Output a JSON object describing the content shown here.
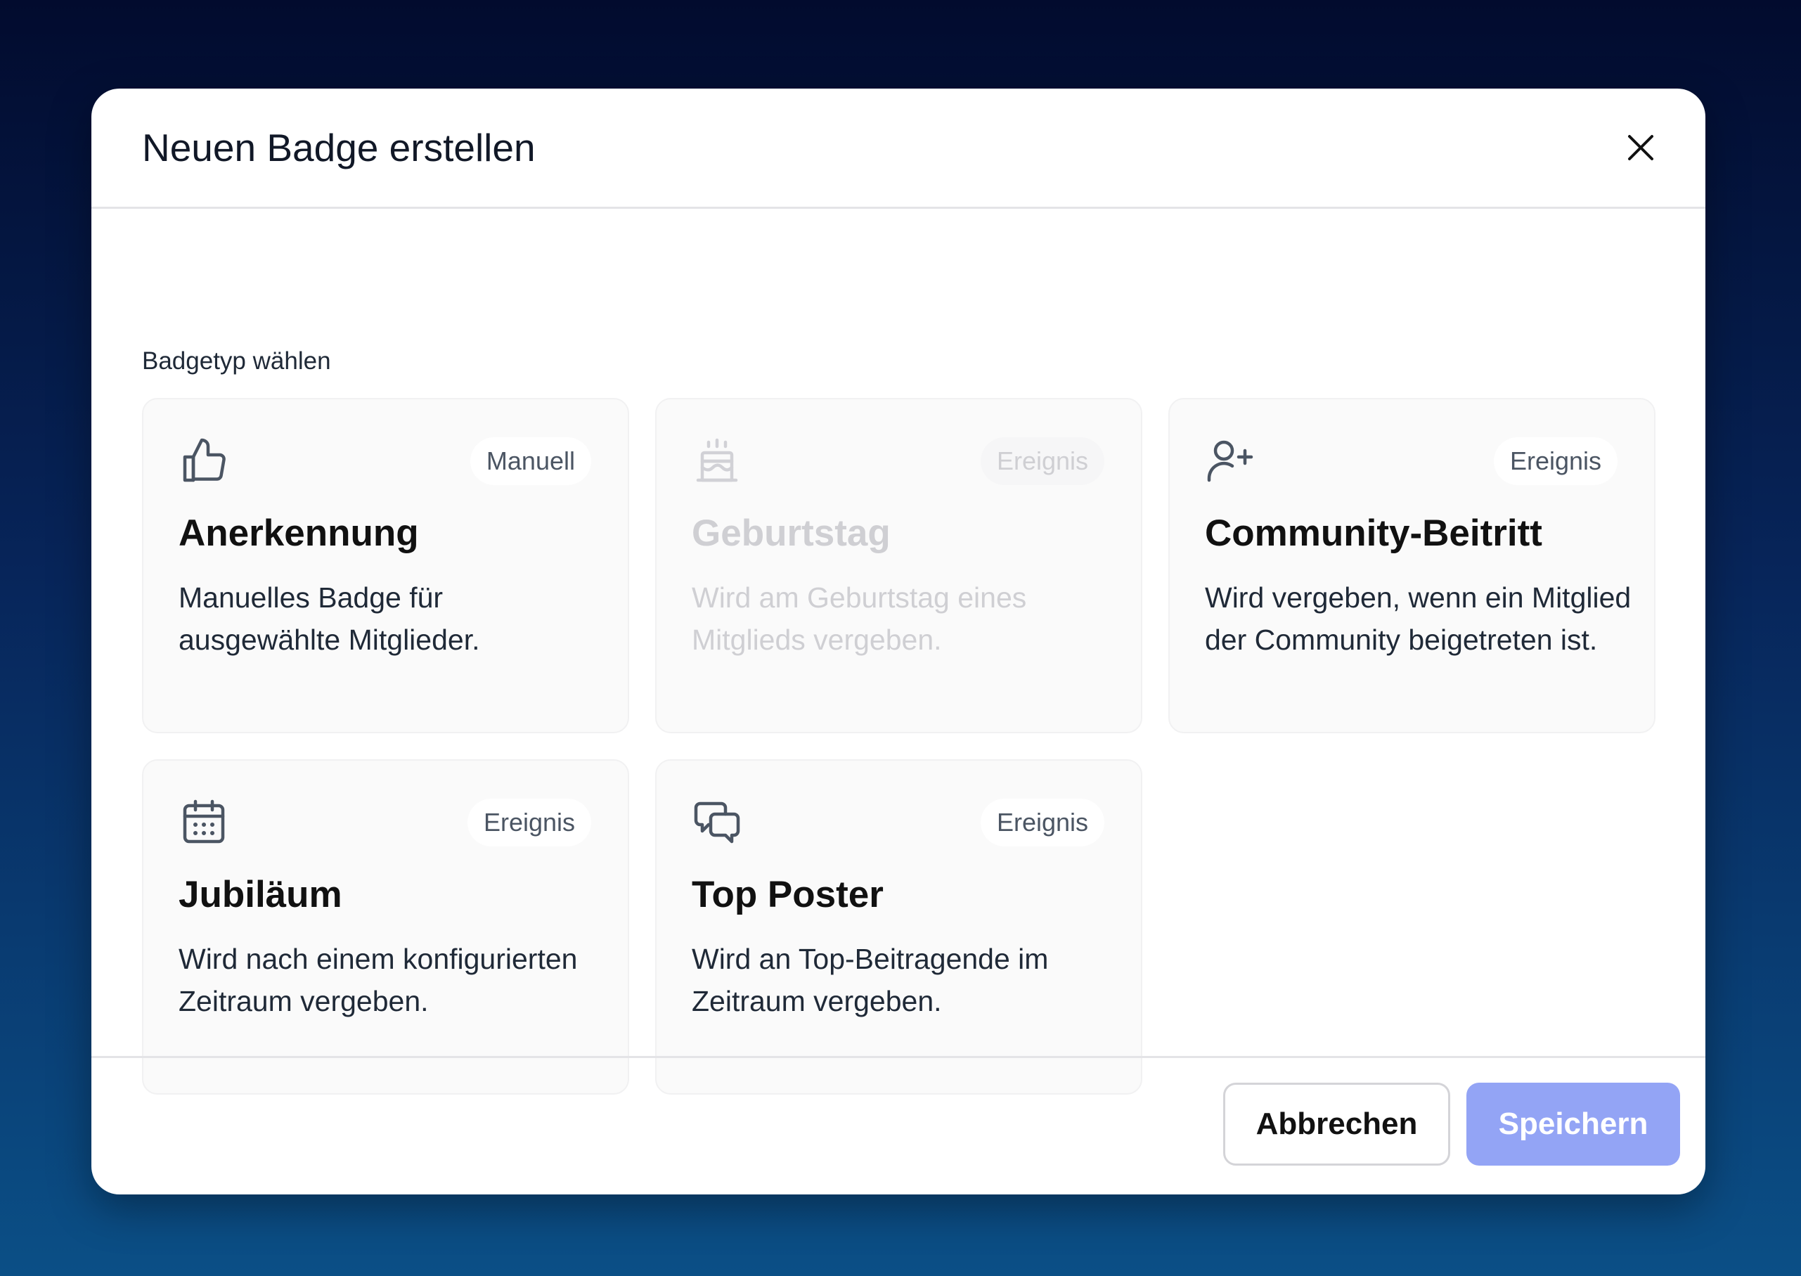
{
  "dialog": {
    "title": "Neuen Badge erstellen",
    "section_label": "Badgetyp wählen",
    "cancel_label": "Abbrechen",
    "save_label": "Speichern"
  },
  "cards": [
    {
      "icon": "thumbs-up-icon",
      "badge": "Manuell",
      "title": "Anerkennung",
      "description": "Manuelles Badge für ausgewählte Mitglieder.",
      "enabled": true
    },
    {
      "icon": "birthday-cake-icon",
      "badge": "Ereignis",
      "title": "Geburtstag",
      "description": "Wird am Geburtstag eines Mitglieds vergeben.",
      "enabled": false
    },
    {
      "icon": "user-plus-icon",
      "badge": "Ereignis",
      "title": "Community-Beitritt",
      "description": "Wird vergeben, wenn ein Mitglied der Community beigetreten ist.",
      "enabled": true
    },
    {
      "icon": "calendar-icon",
      "badge": "Ereignis",
      "title": "Jubiläum",
      "description": "Wird nach einem konfigurierten Zeitraum vergeben.",
      "enabled": true
    },
    {
      "icon": "chat-bubbles-icon",
      "badge": "Ereignis",
      "title": "Top Poster",
      "description": "Wird an Top-Beitragende im Zeitraum vergeben.",
      "enabled": true
    }
  ],
  "colors": {
    "primary_button": "#93a4f5",
    "card_background": "#fafafa",
    "disabled_text": "#cfcfd3"
  }
}
